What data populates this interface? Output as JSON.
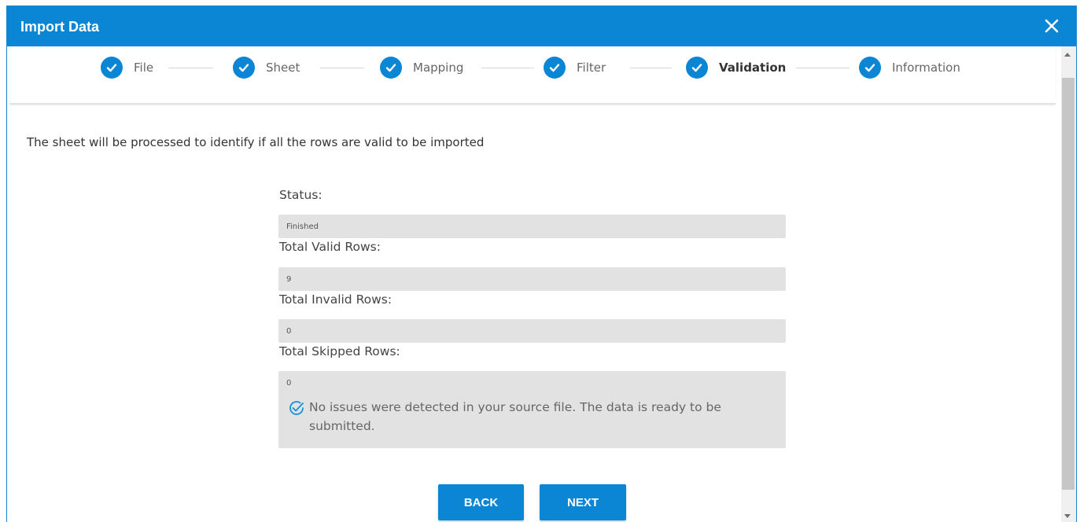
{
  "dialog": {
    "title": "Import Data",
    "close_label": "✕"
  },
  "steps": [
    {
      "label": "File",
      "status": "completed"
    },
    {
      "label": "Sheet",
      "status": "completed"
    },
    {
      "label": "Mapping",
      "status": "completed"
    },
    {
      "label": "Filter",
      "status": "completed"
    },
    {
      "label": "Validation",
      "status": "active"
    },
    {
      "label": "Information",
      "status": "completed"
    }
  ],
  "intro_text": "The sheet will be processed to identify if all the rows are valid to be imported",
  "fields": {
    "status": {
      "label": "Status:",
      "value": "Finished"
    },
    "valid": {
      "label": "Total Valid Rows:",
      "value": "9"
    },
    "invalid": {
      "label": "Total Invalid Rows:",
      "value": "0"
    },
    "skipped": {
      "label": "Total Skipped Rows:",
      "value": "0"
    }
  },
  "notice": {
    "text": "No issues were detected in your source file. The data is ready to be submitted.",
    "icon": "check-circle-icon"
  },
  "buttons": {
    "back": "BACK",
    "next": "NEXT"
  },
  "colors": {
    "accent": "#0b86d4",
    "field_bg": "#e2e2e2"
  }
}
